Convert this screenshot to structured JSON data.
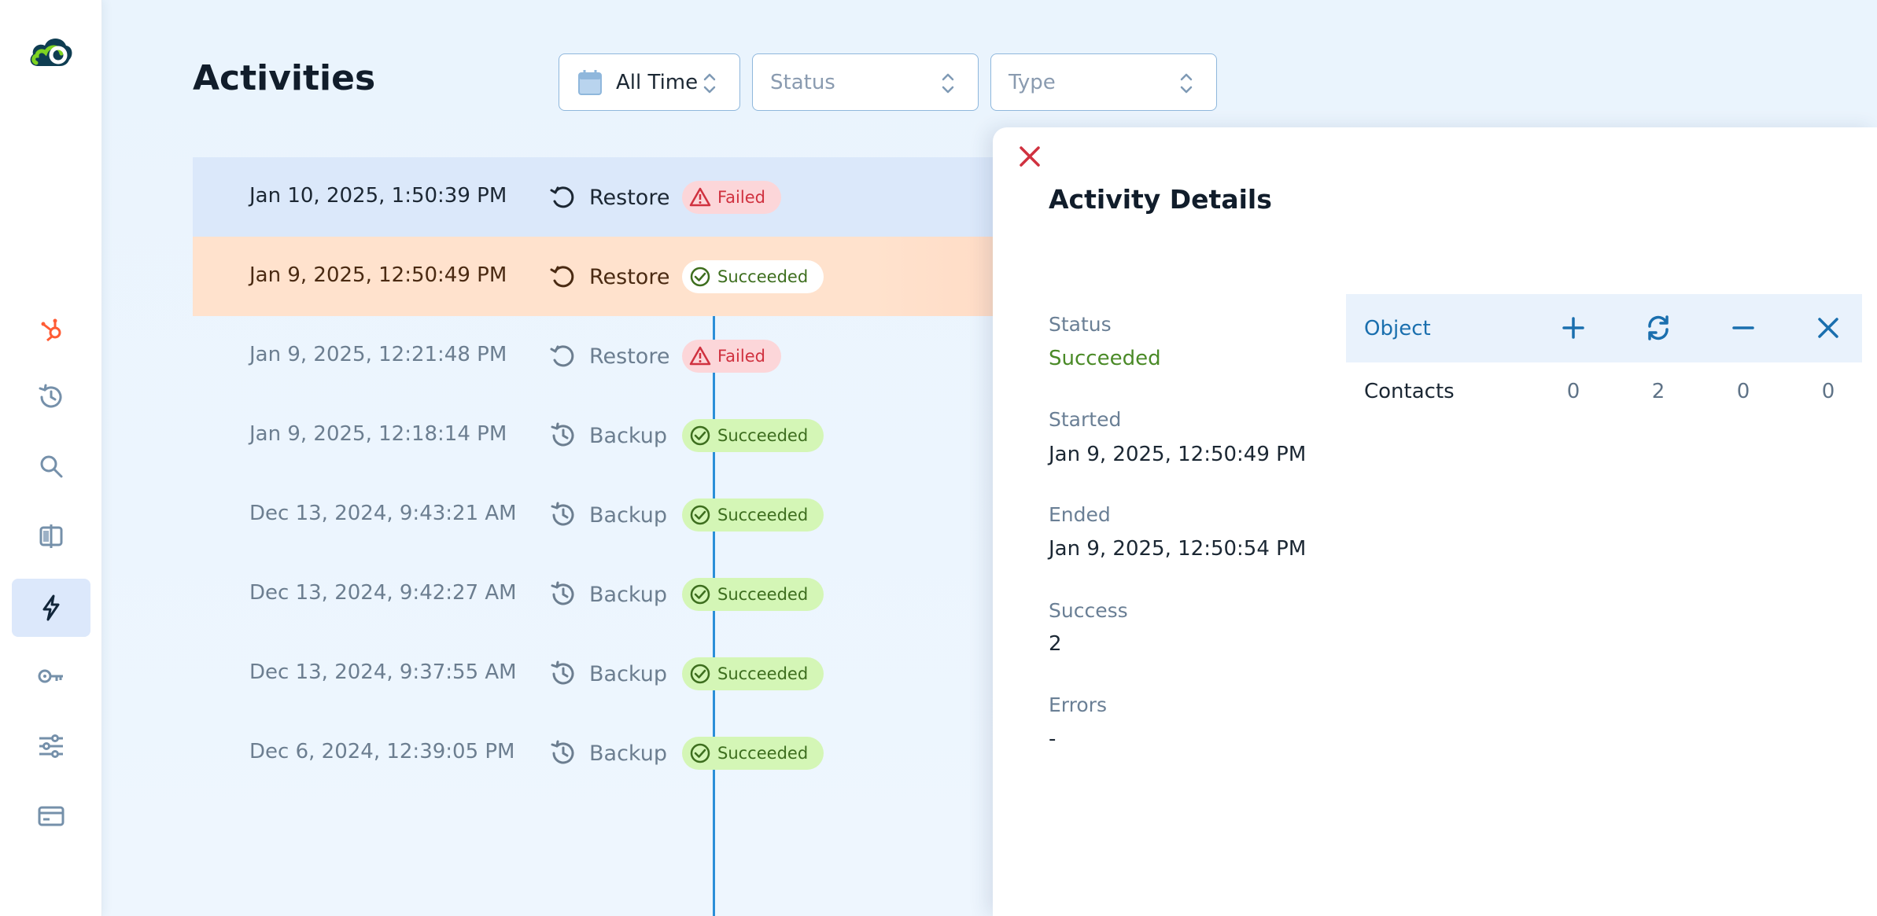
{
  "sidebar": {
    "items": [
      {
        "name": "hubspot-icon"
      },
      {
        "name": "history-icon"
      },
      {
        "name": "search-icon"
      },
      {
        "name": "compare-icon"
      },
      {
        "name": "activity-icon",
        "active": true
      },
      {
        "name": "key-icon"
      },
      {
        "name": "settings-sliders-icon"
      },
      {
        "name": "billing-card-icon"
      }
    ]
  },
  "header": {
    "title": "Activities",
    "filters": {
      "time": "All Time",
      "status_placeholder": "Status",
      "type_placeholder": "Type"
    }
  },
  "activities": [
    {
      "date": "Jan 10, 2025, 1:50:39 PM",
      "type": "Restore",
      "status": "Failed"
    },
    {
      "date": "Jan 9, 2025, 12:50:49 PM",
      "type": "Restore",
      "status": "Succeeded"
    },
    {
      "date": "Jan 9, 2025, 12:21:48 PM",
      "type": "Restore",
      "status": "Failed"
    },
    {
      "date": "Jan 9, 2025, 12:18:14 PM",
      "type": "Backup",
      "status": "Succeeded"
    },
    {
      "date": "Dec 13, 2024, 9:43:21 AM",
      "type": "Backup",
      "status": "Succeeded"
    },
    {
      "date": "Dec 13, 2024, 9:42:27 AM",
      "type": "Backup",
      "status": "Succeeded"
    },
    {
      "date": "Dec 13, 2024, 9:37:55 AM",
      "type": "Backup",
      "status": "Succeeded"
    },
    {
      "date": "Dec 6, 2024, 12:39:05 PM",
      "type": "Backup",
      "status": "Succeeded"
    }
  ],
  "details": {
    "title": "Activity Details",
    "status_label": "Status",
    "status_value": "Succeeded",
    "started_label": "Started",
    "started_value": "Jan 9, 2025, 12:50:49 PM",
    "ended_label": "Ended",
    "ended_value": "Jan 9, 2025, 12:50:54 PM",
    "success_label": "Success",
    "success_value": "2",
    "errors_label": "Errors",
    "errors_value": "-",
    "table": {
      "header": "Object",
      "columns": [
        "added-icon",
        "updated-icon",
        "removed-icon",
        "failed-icon"
      ],
      "rows": [
        {
          "object": "Contacts",
          "values": [
            "0",
            "2",
            "0",
            "0"
          ]
        }
      ]
    }
  },
  "colors": {
    "accent": "#1a6fae",
    "timeline": "#2b8fd8",
    "failed": "#d0313f",
    "succeeded": "#4a8a27",
    "selected_row": "#dbe8fa",
    "hover_row": "#ffe2cd"
  }
}
